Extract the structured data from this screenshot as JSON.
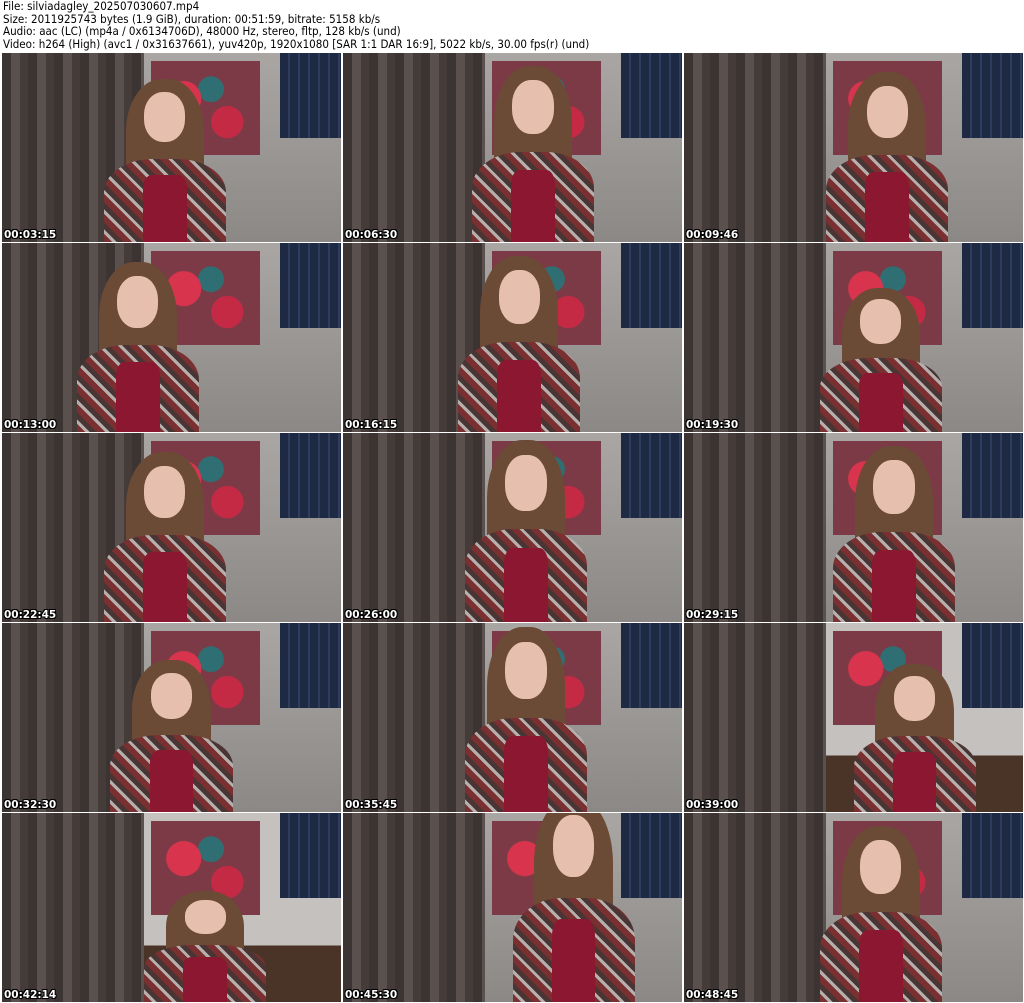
{
  "header": {
    "file": "File: silviadagley_202507030607.mp4",
    "size": "Size: 2011925743 bytes (1.9 GiB), duration: 00:51:59, bitrate: 5158 kb/s",
    "audio": "Audio: aac (LC) (mp4a / 0x6134706D), 48000 Hz, stereo, fltp, 128 kb/s (und)",
    "video": "Video: h264 (High) (avc1 / 0x31637661), yuv420p, 1920x1080 [SAR 1:1 DAR 16:9], 5022 kb/s, 30.00 fps(r) (und)"
  },
  "thumbnails": [
    {
      "time": "00:03:15"
    },
    {
      "time": "00:06:30"
    },
    {
      "time": "00:09:46"
    },
    {
      "time": "00:13:00"
    },
    {
      "time": "00:16:15"
    },
    {
      "time": "00:19:30"
    },
    {
      "time": "00:22:45"
    },
    {
      "time": "00:26:00"
    },
    {
      "time": "00:29:15"
    },
    {
      "time": "00:32:30"
    },
    {
      "time": "00:35:45"
    },
    {
      "time": "00:39:00"
    },
    {
      "time": "00:42:14"
    },
    {
      "time": "00:45:30"
    },
    {
      "time": "00:48:45"
    }
  ]
}
